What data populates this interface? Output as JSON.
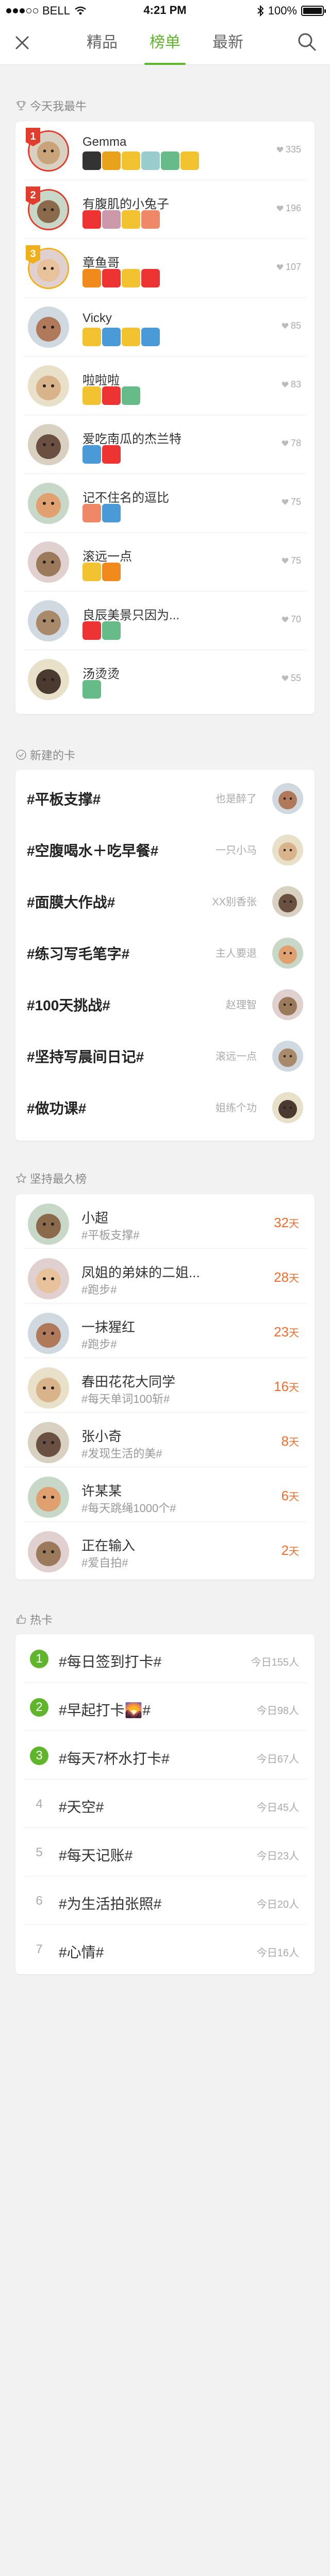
{
  "status_bar": {
    "carrier": "BELL",
    "time": "4:21 PM",
    "battery": "100%"
  },
  "nav": {
    "tabs": [
      {
        "label": "精品",
        "active": false
      },
      {
        "label": "榜单",
        "active": true
      },
      {
        "label": "最新",
        "active": false
      }
    ]
  },
  "colors": {
    "accent": "#5fb52c",
    "days": "#f56c2a",
    "rank1": "#e23c2c",
    "rank3": "#f0b01a"
  },
  "ranking": {
    "title": "今天我最牛",
    "items": [
      {
        "rank": "1",
        "name": "Gemma",
        "likes": "335",
        "stickers": [
          "#333",
          "#e8a21c",
          "#f2c230",
          "#9cc",
          "#6b8",
          "#f2c230"
        ]
      },
      {
        "rank": "2",
        "name": "有腹肌的小兔子",
        "likes": "196",
        "stickers": [
          "#e33",
          "#c9a",
          "#f2c230",
          "#e86"
        ]
      },
      {
        "rank": "3",
        "name": "章鱼哥",
        "likes": "107",
        "stickers": [
          "#f08a1c",
          "#e33",
          "#f2c230",
          "#e33"
        ]
      },
      {
        "rank": "",
        "name": "Vicky",
        "likes": "85",
        "stickers": [
          "#f2c230",
          "#4a9ad8",
          "#f2c230",
          "#4a9ad8"
        ]
      },
      {
        "rank": "",
        "name": "啦啦啦",
        "likes": "83",
        "stickers": [
          "#f2c230",
          "#e33",
          "#6b8"
        ]
      },
      {
        "rank": "",
        "name": "爱吃南瓜的杰兰特",
        "likes": "78",
        "stickers": [
          "#4a9ad8",
          "#e33"
        ]
      },
      {
        "rank": "",
        "name": "记不住名的逗比",
        "likes": "75",
        "stickers": [
          "#e86",
          "#4a9ad8"
        ]
      },
      {
        "rank": "",
        "name": "滚远一点",
        "likes": "75",
        "stickers": [
          "#f2c230",
          "#f08a1c"
        ]
      },
      {
        "rank": "",
        "name": "良辰美景只因为...",
        "likes": "70",
        "stickers": [
          "#e33",
          "#6b8"
        ]
      },
      {
        "rank": "",
        "name": "汤烫烫",
        "likes": "55",
        "stickers": [
          "#6b8"
        ]
      }
    ]
  },
  "new_cards": {
    "title": "新建的卡",
    "items": [
      {
        "title": "#平板支撑#",
        "user": "也是醉了"
      },
      {
        "title": "#空腹喝水＋吃早餐#",
        "user": "一只小马"
      },
      {
        "title": "#面膜大作战#",
        "user": "XX别香张"
      },
      {
        "title": "#练习写毛笔字#",
        "user": "主人要退"
      },
      {
        "title": "#100天挑战#",
        "user": "赵理智"
      },
      {
        "title": "#坚持写晨间日记#",
        "user": "滚远一点"
      },
      {
        "title": "#做功课#",
        "user": "姐练个功"
      }
    ]
  },
  "persistence": {
    "title": "坚持最久榜",
    "day_unit": "天",
    "items": [
      {
        "name": "小超",
        "tag": "#平板支撑#",
        "days": "32"
      },
      {
        "name": "凤姐的弟妹的二姐...",
        "tag": "#跑步#",
        "days": "28"
      },
      {
        "name": "一抹猩红",
        "tag": "#跑步#",
        "days": "23"
      },
      {
        "name": "春田花花大同学",
        "tag": "#每天单词100斩#",
        "days": "16"
      },
      {
        "name": "张小奇",
        "tag": "#发现生活的美#",
        "days": "8"
      },
      {
        "name": "许某某",
        "tag": "#每天跳绳1000个#",
        "days": "6"
      },
      {
        "name": "正在输入",
        "tag": "#爱自拍#",
        "days": "2"
      }
    ]
  },
  "hot": {
    "title": "热卡",
    "items": [
      {
        "num": "1",
        "title": "#每日签到打卡#",
        "count": "今日155人"
      },
      {
        "num": "2",
        "title": "#早起打卡🌄#",
        "count": "今日98人"
      },
      {
        "num": "3",
        "title": "#每天7杯水打卡#",
        "count": "今日67人"
      },
      {
        "num": "4",
        "title": "#天空#",
        "count": "今日45人"
      },
      {
        "num": "5",
        "title": "#每天记账#",
        "count": "今日23人"
      },
      {
        "num": "6",
        "title": "#为生活拍张照#",
        "count": "今日20人"
      },
      {
        "num": "7",
        "title": "#心情#",
        "count": "今日16人"
      }
    ]
  }
}
